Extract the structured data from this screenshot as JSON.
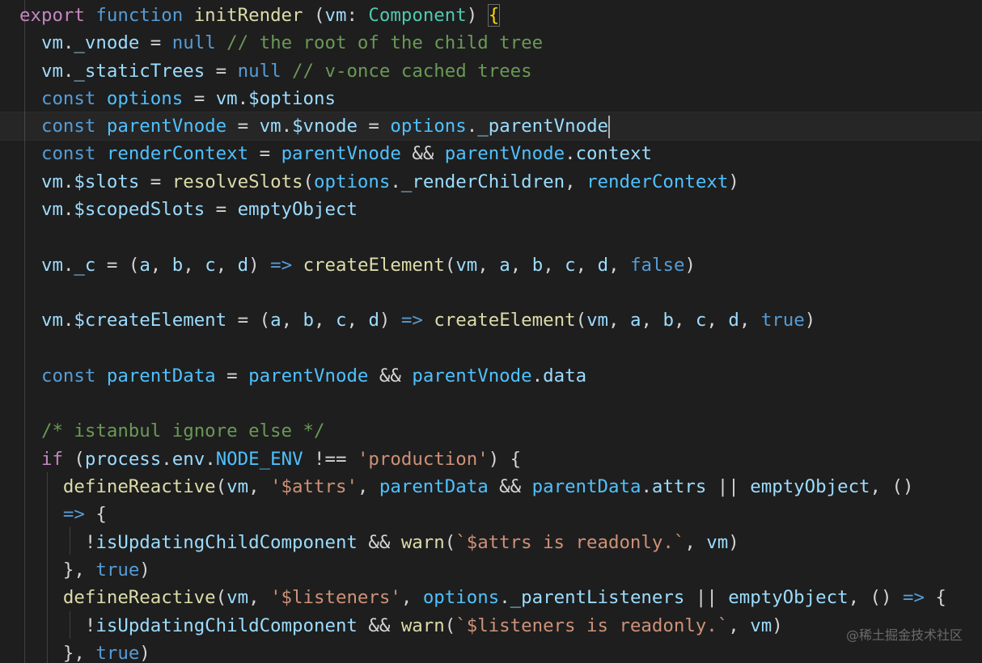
{
  "watermark": "@稀土掘金技术社区",
  "lines": [
    [
      [
        "export",
        "kw"
      ],
      [
        " ",
        "pn"
      ],
      [
        "function",
        "st"
      ],
      [
        " ",
        "pn"
      ],
      [
        "initRender",
        "fn"
      ],
      [
        " (",
        "pn"
      ],
      [
        "vm",
        "vr"
      ],
      [
        ": ",
        "pn"
      ],
      [
        "Component",
        "ty"
      ],
      [
        ") ",
        "pn"
      ],
      [
        "{",
        "br"
      ]
    ],
    [
      [
        "  ",
        "pn"
      ],
      [
        "vm",
        "vr"
      ],
      [
        ".",
        "pn"
      ],
      [
        "_vnode",
        "vr"
      ],
      [
        " = ",
        "pn"
      ],
      [
        "null",
        "st"
      ],
      [
        " ",
        "pn"
      ],
      [
        "// the root of the child tree",
        "cm"
      ]
    ],
    [
      [
        "  ",
        "pn"
      ],
      [
        "vm",
        "vr"
      ],
      [
        ".",
        "pn"
      ],
      [
        "_staticTrees",
        "vr"
      ],
      [
        " = ",
        "pn"
      ],
      [
        "null",
        "st"
      ],
      [
        " ",
        "pn"
      ],
      [
        "// v-once cached trees",
        "cm"
      ]
    ],
    [
      [
        "  ",
        "pn"
      ],
      [
        "const",
        "st"
      ],
      [
        " ",
        "pn"
      ],
      [
        "options",
        "vb"
      ],
      [
        " = ",
        "pn"
      ],
      [
        "vm",
        "vr"
      ],
      [
        ".",
        "pn"
      ],
      [
        "$options",
        "vr"
      ]
    ],
    [
      [
        "  ",
        "pn"
      ],
      [
        "const",
        "st"
      ],
      [
        " ",
        "pn"
      ],
      [
        "parentVnode",
        "vb"
      ],
      [
        " = ",
        "pn"
      ],
      [
        "vm",
        "vr"
      ],
      [
        ".",
        "pn"
      ],
      [
        "$vnode",
        "vr"
      ],
      [
        " = ",
        "pn"
      ],
      [
        "options",
        "vb"
      ],
      [
        ".",
        "pn"
      ],
      [
        "_parentVnode",
        "vr"
      ]
    ],
    [
      [
        "  ",
        "pn"
      ],
      [
        "const",
        "st"
      ],
      [
        " ",
        "pn"
      ],
      [
        "renderContext",
        "vb"
      ],
      [
        " = ",
        "pn"
      ],
      [
        "parentVnode",
        "vb"
      ],
      [
        " && ",
        "pn"
      ],
      [
        "parentVnode",
        "vb"
      ],
      [
        ".",
        "pn"
      ],
      [
        "context",
        "vr"
      ]
    ],
    [
      [
        "  ",
        "pn"
      ],
      [
        "vm",
        "vr"
      ],
      [
        ".",
        "pn"
      ],
      [
        "$slots",
        "vr"
      ],
      [
        " = ",
        "pn"
      ],
      [
        "resolveSlots",
        "fn"
      ],
      [
        "(",
        "pn"
      ],
      [
        "options",
        "vb"
      ],
      [
        ".",
        "pn"
      ],
      [
        "_renderChildren",
        "vr"
      ],
      [
        ", ",
        "pn"
      ],
      [
        "renderContext",
        "vb"
      ],
      [
        ")",
        "pn"
      ]
    ],
    [
      [
        "  ",
        "pn"
      ],
      [
        "vm",
        "vr"
      ],
      [
        ".",
        "pn"
      ],
      [
        "$scopedSlots",
        "vr"
      ],
      [
        " = ",
        "pn"
      ],
      [
        "emptyObject",
        "vr"
      ]
    ],
    [],
    [
      [
        "  ",
        "pn"
      ],
      [
        "vm",
        "vr"
      ],
      [
        ".",
        "pn"
      ],
      [
        "_c",
        "vr"
      ],
      [
        " = (",
        "pn"
      ],
      [
        "a",
        "vr"
      ],
      [
        ", ",
        "pn"
      ],
      [
        "b",
        "vr"
      ],
      [
        ", ",
        "pn"
      ],
      [
        "c",
        "vr"
      ],
      [
        ", ",
        "pn"
      ],
      [
        "d",
        "vr"
      ],
      [
        ") ",
        "pn"
      ],
      [
        "=>",
        "st"
      ],
      [
        " ",
        "pn"
      ],
      [
        "createElement",
        "fn"
      ],
      [
        "(",
        "pn"
      ],
      [
        "vm",
        "vr"
      ],
      [
        ", ",
        "pn"
      ],
      [
        "a",
        "vr"
      ],
      [
        ", ",
        "pn"
      ],
      [
        "b",
        "vr"
      ],
      [
        ", ",
        "pn"
      ],
      [
        "c",
        "vr"
      ],
      [
        ", ",
        "pn"
      ],
      [
        "d",
        "vr"
      ],
      [
        ", ",
        "pn"
      ],
      [
        "false",
        "st"
      ],
      [
        ")",
        "pn"
      ]
    ],
    [],
    [
      [
        "  ",
        "pn"
      ],
      [
        "vm",
        "vr"
      ],
      [
        ".",
        "pn"
      ],
      [
        "$createElement",
        "vr"
      ],
      [
        " = (",
        "pn"
      ],
      [
        "a",
        "vr"
      ],
      [
        ", ",
        "pn"
      ],
      [
        "b",
        "vr"
      ],
      [
        ", ",
        "pn"
      ],
      [
        "c",
        "vr"
      ],
      [
        ", ",
        "pn"
      ],
      [
        "d",
        "vr"
      ],
      [
        ") ",
        "pn"
      ],
      [
        "=>",
        "st"
      ],
      [
        " ",
        "pn"
      ],
      [
        "createElement",
        "fn"
      ],
      [
        "(",
        "pn"
      ],
      [
        "vm",
        "vr"
      ],
      [
        ", ",
        "pn"
      ],
      [
        "a",
        "vr"
      ],
      [
        ", ",
        "pn"
      ],
      [
        "b",
        "vr"
      ],
      [
        ", ",
        "pn"
      ],
      [
        "c",
        "vr"
      ],
      [
        ", ",
        "pn"
      ],
      [
        "d",
        "vr"
      ],
      [
        ", ",
        "pn"
      ],
      [
        "true",
        "st"
      ],
      [
        ")",
        "pn"
      ]
    ],
    [],
    [
      [
        "  ",
        "pn"
      ],
      [
        "const",
        "st"
      ],
      [
        " ",
        "pn"
      ],
      [
        "parentData",
        "vb"
      ],
      [
        " = ",
        "pn"
      ],
      [
        "parentVnode",
        "vb"
      ],
      [
        " && ",
        "pn"
      ],
      [
        "parentVnode",
        "vb"
      ],
      [
        ".",
        "pn"
      ],
      [
        "data",
        "vr"
      ]
    ],
    [],
    [
      [
        "  ",
        "pn"
      ],
      [
        "/* istanbul ignore else */",
        "cm"
      ]
    ],
    [
      [
        "  ",
        "pn"
      ],
      [
        "if",
        "kw"
      ],
      [
        " (",
        "pn"
      ],
      [
        "process",
        "vr"
      ],
      [
        ".",
        "pn"
      ],
      [
        "env",
        "vr"
      ],
      [
        ".",
        "pn"
      ],
      [
        "NODE_ENV",
        "vb"
      ],
      [
        " !== ",
        "pn"
      ],
      [
        "'production'",
        "sr"
      ],
      [
        ") {",
        "pn"
      ]
    ],
    [
      [
        "    ",
        "pn"
      ],
      [
        "defineReactive",
        "fn"
      ],
      [
        "(",
        "pn"
      ],
      [
        "vm",
        "vr"
      ],
      [
        ", ",
        "pn"
      ],
      [
        "'$attrs'",
        "sr"
      ],
      [
        ", ",
        "pn"
      ],
      [
        "parentData",
        "vb"
      ],
      [
        " && ",
        "pn"
      ],
      [
        "parentData",
        "vb"
      ],
      [
        ".",
        "pn"
      ],
      [
        "attrs",
        "vr"
      ],
      [
        " || ",
        "pn"
      ],
      [
        "emptyObject",
        "vr"
      ],
      [
        ", ()",
        "pn"
      ]
    ],
    [
      [
        "    ",
        "pn"
      ],
      [
        "=>",
        "st"
      ],
      [
        " {",
        "pn"
      ]
    ],
    [
      [
        "      ",
        "pn"
      ],
      [
        "!",
        "pn"
      ],
      [
        "isUpdatingChildComponent",
        "vr"
      ],
      [
        " && ",
        "pn"
      ],
      [
        "warn",
        "fn"
      ],
      [
        "(",
        "pn"
      ],
      [
        "`$attrs is readonly.`",
        "sr"
      ],
      [
        ", ",
        "pn"
      ],
      [
        "vm",
        "vr"
      ],
      [
        ")",
        "pn"
      ]
    ],
    [
      [
        "    }, ",
        "pn"
      ],
      [
        "true",
        "st"
      ],
      [
        ")",
        "pn"
      ]
    ],
    [
      [
        "    ",
        "pn"
      ],
      [
        "defineReactive",
        "fn"
      ],
      [
        "(",
        "pn"
      ],
      [
        "vm",
        "vr"
      ],
      [
        ", ",
        "pn"
      ],
      [
        "'$listeners'",
        "sr"
      ],
      [
        ", ",
        "pn"
      ],
      [
        "options",
        "vb"
      ],
      [
        ".",
        "pn"
      ],
      [
        "_parentListeners",
        "vr"
      ],
      [
        " || ",
        "pn"
      ],
      [
        "emptyObject",
        "vr"
      ],
      [
        ", () ",
        "pn"
      ],
      [
        "=>",
        "st"
      ],
      [
        " {",
        "pn"
      ]
    ],
    [
      [
        "      ",
        "pn"
      ],
      [
        "!",
        "pn"
      ],
      [
        "isUpdatingChildComponent",
        "vr"
      ],
      [
        " && ",
        "pn"
      ],
      [
        "warn",
        "fn"
      ],
      [
        "(",
        "pn"
      ],
      [
        "`$listeners is readonly.`",
        "sr"
      ],
      [
        ", ",
        "pn"
      ],
      [
        "vm",
        "vr"
      ],
      [
        ")",
        "pn"
      ]
    ],
    [
      [
        "    }, ",
        "pn"
      ],
      [
        "true",
        "st"
      ],
      [
        ")",
        "pn"
      ]
    ]
  ]
}
